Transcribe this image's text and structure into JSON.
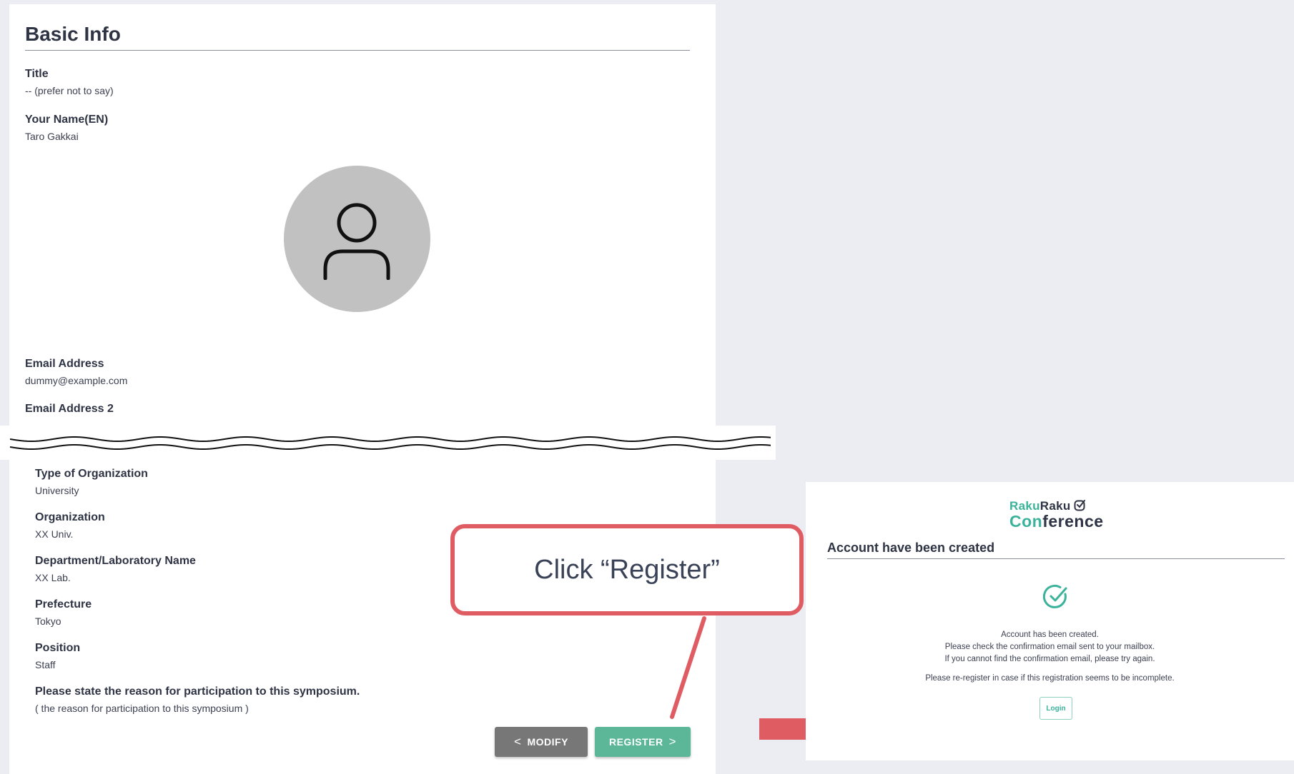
{
  "basic_info": {
    "title": "Basic Info",
    "fields": [
      {
        "label": "Title",
        "value": "-- (prefer not to say)"
      },
      {
        "label": "Your Name(EN)",
        "value": "Taro  Gakkai"
      },
      {
        "label": "Email Address",
        "value": "dummy@example.com"
      },
      {
        "label": "Email Address 2",
        "value": ""
      }
    ]
  },
  "org_info": {
    "fields": [
      {
        "label": "Type of Organization",
        "value": "University"
      },
      {
        "label": "Organization",
        "value": "XX Univ."
      },
      {
        "label": "Department/Laboratory Name",
        "value": "XX Lab."
      },
      {
        "label": "Prefecture",
        "value": "Tokyo"
      },
      {
        "label": "Position",
        "value": "Staff"
      },
      {
        "label": "Please state the reason for participation to this symposium.",
        "value": "( the reason for participation to this symposium )"
      }
    ]
  },
  "buttons": {
    "modify": {
      "chevron": "<",
      "label": "MODIFY"
    },
    "register": {
      "label": "REGISTER",
      "chevron": ">"
    }
  },
  "callout": {
    "text": "Click “Register”"
  },
  "confirmation": {
    "logo_line1_a": "Raku",
    "logo_line1_b": "Raku",
    "logo_line2_a": "Con",
    "logo_line2_b": "ference",
    "title": "Account have been created",
    "messages": [
      "Account has been created.",
      "Please check the confirmation email sent to your mailbox.",
      "If you cannot find the confirmation email, please try again.",
      "Please re-register in case if this registration seems to be incomplete."
    ],
    "login_label": "Login"
  },
  "colors": {
    "accent_green": "#3bb39b",
    "register_green": "#5bb798",
    "callout_red": "#e05c63",
    "modify_gray": "#777777"
  },
  "icons": {
    "avatar": "user-silhouette-icon",
    "success": "check-circle-icon",
    "logo": "check-badge-icon",
    "arrow": "right-arrow-icon",
    "break": "wavy-break-lines"
  }
}
